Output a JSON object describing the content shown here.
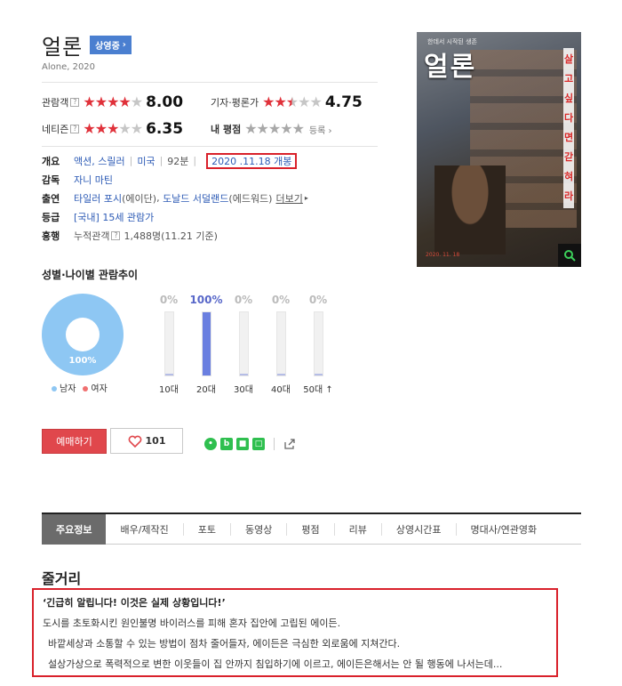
{
  "movie": {
    "title": "얼론",
    "status_badge": "상영중",
    "subtitle": "Alone, 2020"
  },
  "ratings": {
    "audience": {
      "label": "관람객",
      "score": "8.00",
      "stars_filled": 4
    },
    "critics": {
      "label": "기자·평론가",
      "score": "4.75",
      "stars_filled": 2.5
    },
    "netizen": {
      "label": "네티즌",
      "score": "6.35",
      "stars_filled": 3
    },
    "my_rating": {
      "label": "내 평점",
      "action": "등록"
    }
  },
  "info": {
    "overview_key": "개요",
    "genre": "액션, 스릴러",
    "country": "미국",
    "runtime": "92분",
    "release": "2020 .11.18 개봉",
    "director_key": "감독",
    "director": "자니 마틴",
    "cast_key": "출연",
    "cast_1": "타일러 포시",
    "cast_1_role": "(에이단)",
    "cast_2": "도날드 서덜랜드",
    "cast_2_role": "(에드워드)",
    "cast_more": "더보기",
    "grade_key": "등급",
    "grade": "[국내] 15세 관람가",
    "boxoffice_key": "흥행",
    "boxoffice_label": "누적관객",
    "boxoffice_value": "1,488명(11.21 기준)"
  },
  "poster": {
    "title": "얼론",
    "small_text": "한데서 시작된 생존",
    "side_text": [
      "살",
      "고",
      "싶",
      "다",
      "면",
      "갇",
      "혀",
      "라"
    ],
    "date": "2020. 11. 18"
  },
  "demographics": {
    "title": "성별·나이별 관람추이",
    "gender_pct": "100%",
    "male_label": "남자",
    "female_label": "여자",
    "male_share": 1.0,
    "ages": [
      {
        "label": "10대",
        "pct": "0%",
        "value": 0
      },
      {
        "label": "20대",
        "pct": "100%",
        "value": 100
      },
      {
        "label": "30대",
        "pct": "0%",
        "value": 0
      },
      {
        "label": "40대",
        "pct": "0%",
        "value": 0
      },
      {
        "label": "50대 ↑",
        "pct": "0%",
        "value": 0
      }
    ]
  },
  "actions": {
    "buy_label": "예매하기",
    "like_count": "101"
  },
  "tabs": [
    "주요정보",
    "배우/제작진",
    "포토",
    "동영상",
    "평점",
    "리뷰",
    "상영시간표",
    "명대사/연관영화"
  ],
  "plot": {
    "heading": "줄거리",
    "lead": "‘긴급히 알립니다! 이것은 실제 상황입니다!’",
    "lines": [
      "도시를 초토화시킨 원인불명 바이러스를 피해 혼자 집안에 고립된 에이든.",
      "바깥세상과 소통할 수 있는 방법이 점차 줄어들자, 에이든은 극심한 외로움에 지쳐간다.",
      "설상가상으로 폭력적으로 변한 이웃들이 집 안까지 침입하기에 이르고, 에이든은해서는 안 될 행동에 나서는데..."
    ]
  },
  "colors": {
    "accent_red": "#e0313a",
    "badge_blue": "#4a7fd0",
    "donut_male": "#8ec7f3",
    "age_active": "#6a7fe0"
  }
}
